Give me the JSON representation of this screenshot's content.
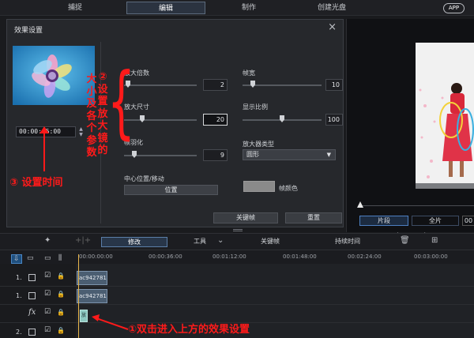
{
  "topbar": {
    "tabs": [
      "捕捉",
      "编辑",
      "制作",
      "创建光盘"
    ],
    "app_label": "APP"
  },
  "dialog": {
    "title": "效果设置",
    "timecode": "00:00:05:00",
    "params": {
      "zoom_factor": {
        "label": "放大倍数",
        "value": "2"
      },
      "zoom_size": {
        "label": "放大尺寸",
        "value": "20"
      },
      "frame_feather": {
        "label": "帧羽化",
        "value": "9"
      },
      "frame_width": {
        "label": "帧宽",
        "value": "10"
      },
      "display_ratio": {
        "label": "显示比例",
        "value": "100"
      },
      "magnifier_type": {
        "label": "放大器类型",
        "value": "圆形"
      },
      "center_label": "中心位置/移动",
      "position_button": "位置",
      "frame_color_label": "帧颜色"
    },
    "keyframe_button": "关键帧",
    "reset_button": "重置"
  },
  "preview": {
    "segment_tab": "片段",
    "full_tab": "全片",
    "time_readout": "00"
  },
  "timeline": {
    "toolbar": {
      "modify": "修改",
      "tools": "工具",
      "keyframe": "关键帧",
      "duration": "持续时间"
    },
    "ruler": [
      "00:00:00:00",
      "00:00:36:00",
      "00:01:12:00",
      "00:01:48:00",
      "00:02:24:00",
      "00:03:00:00"
    ],
    "tracks": [
      {
        "label": "1.",
        "clip": "ac9427818"
      },
      {
        "label": "1.",
        "clip": "ac9427818"
      },
      {
        "label": "fx",
        "clip": "放"
      },
      {
        "label": "2."
      }
    ]
  },
  "annotations": {
    "size_col1": [
      "大",
      "小",
      "及",
      "各",
      "个",
      "参",
      "数"
    ],
    "size_col2": [
      "②",
      "设",
      "置",
      "放",
      "大",
      "镜",
      "的"
    ],
    "set_time": "③ 设置时间",
    "double_click": "①双击进入上方的效果设置"
  },
  "colors": {
    "annotation_red": "#ff1a1a",
    "dialog_bg": "#26282c",
    "frame_color_swatch": "#8a8a8a"
  }
}
